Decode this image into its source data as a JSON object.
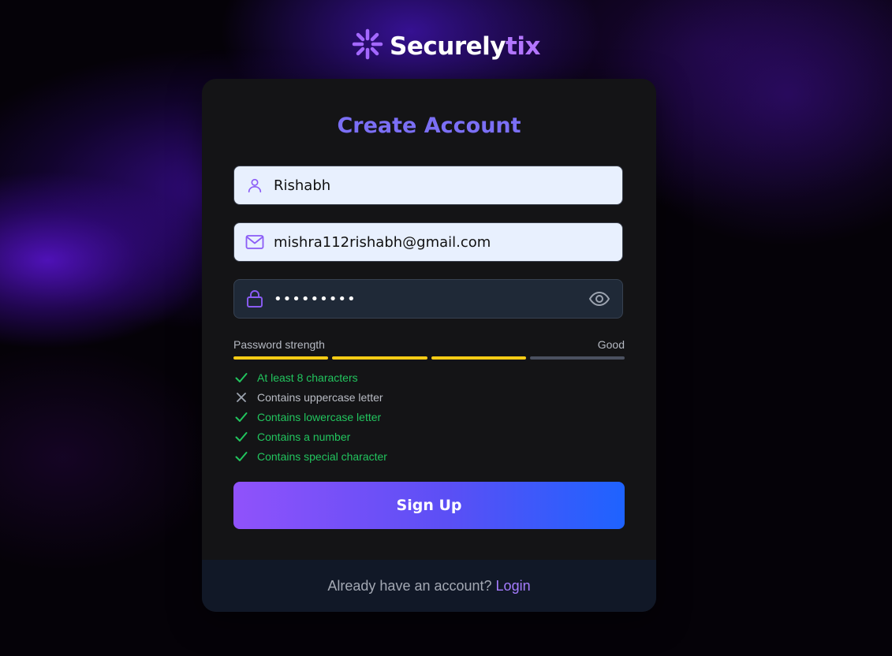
{
  "brand": {
    "name_main": "Securely",
    "name_accent": "tix",
    "accent_color": "#b376ff"
  },
  "form": {
    "title": "Create Account",
    "name_value": "Rishabh",
    "email_value": "mishra112rishabh@gmail.com",
    "password_value": "•••••••••",
    "icons": {
      "name": "user-icon",
      "email": "mail-icon",
      "password": "lock-icon",
      "visibility": "eye-icon"
    }
  },
  "strength": {
    "label": "Password strength",
    "level": "Good",
    "filled_segments": 3,
    "total_segments": 4,
    "bar_color": "#facc15"
  },
  "requirements": [
    {
      "text": "At least 8 characters",
      "met": true
    },
    {
      "text": "Contains uppercase letter",
      "met": false
    },
    {
      "text": "Contains lowercase letter",
      "met": true
    },
    {
      "text": "Contains a number",
      "met": true
    },
    {
      "text": "Contains special character",
      "met": true
    }
  ],
  "actions": {
    "signup_label": "Sign Up"
  },
  "footer": {
    "prompt": "Already have an account?",
    "login_label": "Login"
  },
  "colors": {
    "title": "#7b6ff5",
    "success": "#22c55e",
    "button_gradient_start": "#9052fb",
    "button_gradient_end": "#1e63ff"
  }
}
